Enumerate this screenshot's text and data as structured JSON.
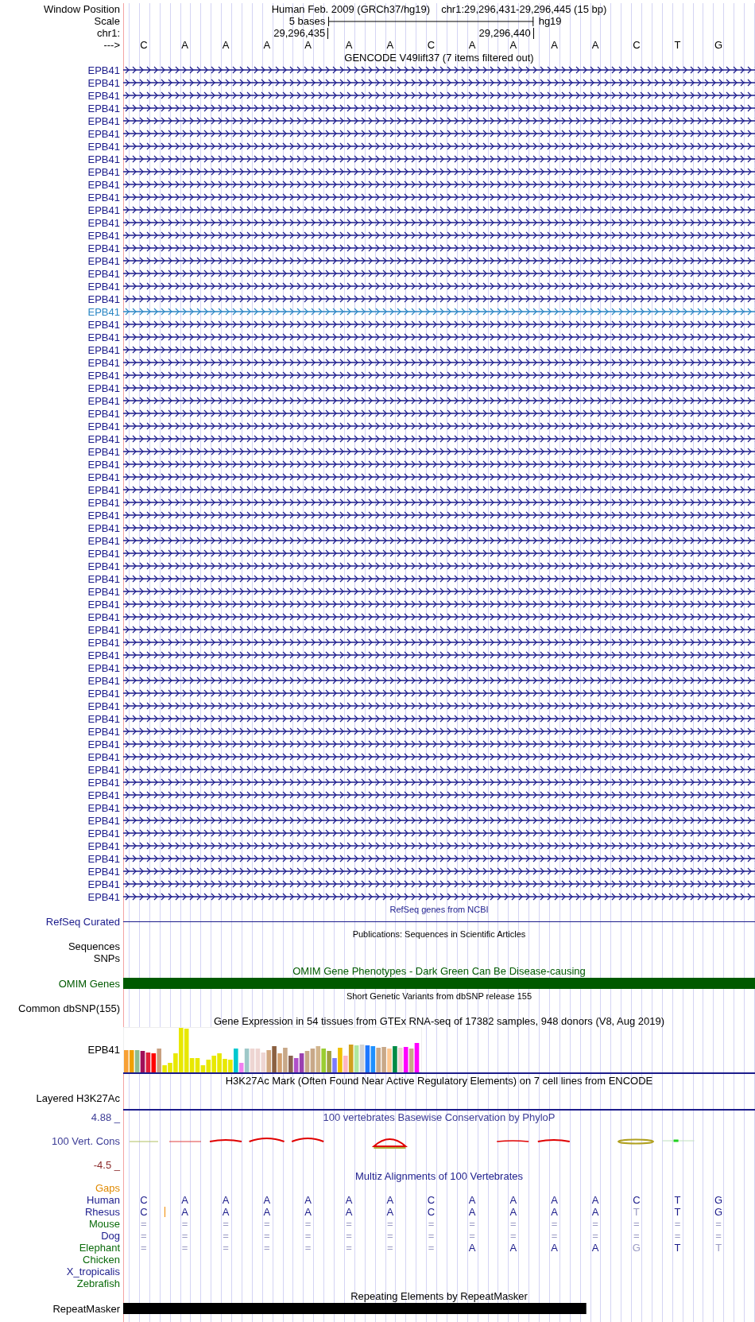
{
  "position": {
    "label": "Window Position",
    "assembly": "Human Feb. 2009 (GRCh37/hg19)",
    "range": "chr1:29,296,431-29,296,445 (15 bp)"
  },
  "scale": {
    "label": "Scale",
    "span": "5 bases",
    "db": "hg19"
  },
  "coordinates": {
    "label": "chr1:",
    "ticks": [
      "29,296,435",
      "29,296,440"
    ]
  },
  "sequence": {
    "label": "--->",
    "bases": [
      "C",
      "A",
      "A",
      "A",
      "A",
      "A",
      "A",
      "C",
      "A",
      "A",
      "A",
      "A",
      "C",
      "T",
      "G"
    ]
  },
  "tracks": [
    {
      "kind": "genes",
      "title": "GENCODE V49lift37 (7 items filtered out)",
      "items": [
        {
          "name": "EPB41",
          "selected": false
        },
        {
          "name": "EPB41",
          "selected": false
        },
        {
          "name": "EPB41",
          "selected": false
        },
        {
          "name": "EPB41",
          "selected": false
        },
        {
          "name": "EPB41",
          "selected": false
        },
        {
          "name": "EPB41",
          "selected": false
        },
        {
          "name": "EPB41",
          "selected": false
        },
        {
          "name": "EPB41",
          "selected": false
        },
        {
          "name": "EPB41",
          "selected": false
        },
        {
          "name": "EPB41",
          "selected": false
        },
        {
          "name": "EPB41",
          "selected": false
        },
        {
          "name": "EPB41",
          "selected": false
        },
        {
          "name": "EPB41",
          "selected": false
        },
        {
          "name": "EPB41",
          "selected": false
        },
        {
          "name": "EPB41",
          "selected": false
        },
        {
          "name": "EPB41",
          "selected": false
        },
        {
          "name": "EPB41",
          "selected": false
        },
        {
          "name": "EPB41",
          "selected": false
        },
        {
          "name": "EPB41",
          "selected": false
        },
        {
          "name": "EPB41",
          "selected": true
        },
        {
          "name": "EPB41",
          "selected": false
        },
        {
          "name": "EPB41",
          "selected": false
        },
        {
          "name": "EPB41",
          "selected": false
        },
        {
          "name": "EPB41",
          "selected": false
        },
        {
          "name": "EPB41",
          "selected": false
        },
        {
          "name": "EPB41",
          "selected": false
        },
        {
          "name": "EPB41",
          "selected": false
        },
        {
          "name": "EPB41",
          "selected": false
        },
        {
          "name": "EPB41",
          "selected": false
        },
        {
          "name": "EPB41",
          "selected": false
        },
        {
          "name": "EPB41",
          "selected": false
        },
        {
          "name": "EPB41",
          "selected": false
        },
        {
          "name": "EPB41",
          "selected": false
        },
        {
          "name": "EPB41",
          "selected": false
        },
        {
          "name": "EPB41",
          "selected": false
        },
        {
          "name": "EPB41",
          "selected": false
        },
        {
          "name": "EPB41",
          "selected": false
        },
        {
          "name": "EPB41",
          "selected": false
        },
        {
          "name": "EPB41",
          "selected": false
        },
        {
          "name": "EPB41",
          "selected": false
        },
        {
          "name": "EPB41",
          "selected": false
        },
        {
          "name": "EPB41",
          "selected": false
        },
        {
          "name": "EPB41",
          "selected": false
        },
        {
          "name": "EPB41",
          "selected": false
        },
        {
          "name": "EPB41",
          "selected": false
        },
        {
          "name": "EPB41",
          "selected": false
        },
        {
          "name": "EPB41",
          "selected": false
        },
        {
          "name": "EPB41",
          "selected": false
        },
        {
          "name": "EPB41",
          "selected": false
        },
        {
          "name": "EPB41",
          "selected": false
        },
        {
          "name": "EPB41",
          "selected": false
        },
        {
          "name": "EPB41",
          "selected": false
        },
        {
          "name": "EPB41",
          "selected": false
        },
        {
          "name": "EPB41",
          "selected": false
        },
        {
          "name": "EPB41",
          "selected": false
        },
        {
          "name": "EPB41",
          "selected": false
        },
        {
          "name": "EPB41",
          "selected": false
        },
        {
          "name": "EPB41",
          "selected": false
        },
        {
          "name": "EPB41",
          "selected": false
        },
        {
          "name": "EPB41",
          "selected": false
        },
        {
          "name": "EPB41",
          "selected": false
        },
        {
          "name": "EPB41",
          "selected": false
        },
        {
          "name": "EPB41",
          "selected": false
        },
        {
          "name": "EPB41",
          "selected": false
        },
        {
          "name": "EPB41",
          "selected": false
        },
        {
          "name": "EPB41",
          "selected": false
        }
      ]
    },
    {
      "kind": "line",
      "title": "RefSeq genes from NCBI",
      "labels": [
        "RefSeq Curated"
      ],
      "color": "#1c1c8c"
    },
    {
      "kind": "empty",
      "title": "Publications: Sequences in Scientific Articles",
      "labels": [
        "Sequences",
        "SNPs"
      ],
      "color": "#000000"
    },
    {
      "kind": "bar",
      "title": "OMIM Gene Phenotypes - Dark Green Can Be Disease-causing",
      "labels": [
        "OMIM Genes"
      ],
      "color": "#005a00",
      "level": 1
    },
    {
      "kind": "empty",
      "title": "Short Genetic Variants from dbSNP release 155",
      "labels": [
        "Common dbSNP(155)"
      ],
      "color": "#000000"
    },
    {
      "kind": "expression",
      "title": "Gene Expression in 54 tissues from GTEx RNA-seq of 17382 samples, 948 donors (V8, Aug 2019)",
      "labels": [
        "EPB41"
      ],
      "color": "#000000"
    },
    {
      "kind": "layered",
      "title": "H3K27Ac Mark (Often Found Near Active Regulatory Elements) on 7 cell lines from ENCODE",
      "labels": [
        "Layered H3K27Ac"
      ],
      "color": "#000000"
    },
    {
      "kind": "wiggle",
      "title": "100 vertebrates Basewise Conservation by PhyloP",
      "max": "4.88 _",
      "name": "100 Vert. Cons",
      "min": "-4.5 _",
      "color": "#3c3c96"
    },
    {
      "kind": "alignment",
      "title": "Multiz Alignments of 100 Vertebrates",
      "gaps": "Gaps",
      "species": [
        {
          "name": "Human",
          "color": "#1c1c8c",
          "bases": [
            {
              "b": "C",
              "faded": false
            },
            {
              "b": "A",
              "faded": false
            },
            {
              "b": "A",
              "faded": false
            },
            {
              "b": "A",
              "faded": false
            },
            {
              "b": "A",
              "faded": false
            },
            {
              "b": "A",
              "faded": false
            },
            {
              "b": "A",
              "faded": false
            },
            {
              "b": "C",
              "faded": false
            },
            {
              "b": "A",
              "faded": false
            },
            {
              "b": "A",
              "faded": false
            },
            {
              "b": "A",
              "faded": false
            },
            {
              "b": "A",
              "faded": false
            },
            {
              "b": "C",
              "faded": false
            },
            {
              "b": "T",
              "faded": false
            },
            {
              "b": "G",
              "faded": false
            }
          ]
        },
        {
          "name": "Rhesus",
          "color": "#1c1c8c",
          "bases": [
            {
              "b": "C",
              "faded": false,
              "insertion": true
            },
            {
              "b": "A",
              "faded": false
            },
            {
              "b": "A",
              "faded": false
            },
            {
              "b": "A",
              "faded": false
            },
            {
              "b": "A",
              "faded": false
            },
            {
              "b": "A",
              "faded": false
            },
            {
              "b": "A",
              "faded": false
            },
            {
              "b": "C",
              "faded": false
            },
            {
              "b": "A",
              "faded": false
            },
            {
              "b": "A",
              "faded": false
            },
            {
              "b": "A",
              "faded": false
            },
            {
              "b": "A",
              "faded": false
            },
            {
              "b": "T",
              "faded": true
            },
            {
              "b": "T",
              "faded": false
            },
            {
              "b": "G",
              "faded": false
            }
          ]
        },
        {
          "name": "Mouse",
          "color": "#0b6b0b",
          "bases": [
            {
              "b": "=",
              "faded": true
            },
            {
              "b": "=",
              "faded": true
            },
            {
              "b": "=",
              "faded": true
            },
            {
              "b": "=",
              "faded": true
            },
            {
              "b": "=",
              "faded": true
            },
            {
              "b": "=",
              "faded": true
            },
            {
              "b": "=",
              "faded": true
            },
            {
              "b": "=",
              "faded": true
            },
            {
              "b": "=",
              "faded": true
            },
            {
              "b": "=",
              "faded": true
            },
            {
              "b": "=",
              "faded": true
            },
            {
              "b": "=",
              "faded": true
            },
            {
              "b": "=",
              "faded": true
            },
            {
              "b": "=",
              "faded": true
            },
            {
              "b": "=",
              "faded": true
            }
          ]
        },
        {
          "name": "Dog",
          "color": "#1c1c8c",
          "bases": [
            {
              "b": "=",
              "faded": true
            },
            {
              "b": "=",
              "faded": true
            },
            {
              "b": "=",
              "faded": true
            },
            {
              "b": "=",
              "faded": true
            },
            {
              "b": "=",
              "faded": true
            },
            {
              "b": "=",
              "faded": true
            },
            {
              "b": "=",
              "faded": true
            },
            {
              "b": "=",
              "faded": true
            },
            {
              "b": "=",
              "faded": true
            },
            {
              "b": "=",
              "faded": true
            },
            {
              "b": "=",
              "faded": true
            },
            {
              "b": "=",
              "faded": true
            },
            {
              "b": "=",
              "faded": true
            },
            {
              "b": "=",
              "faded": true
            },
            {
              "b": "=",
              "faded": true
            }
          ]
        },
        {
          "name": "Elephant",
          "color": "#0b6b0b",
          "bases": [
            {
              "b": "=",
              "faded": true
            },
            {
              "b": "=",
              "faded": true
            },
            {
              "b": "=",
              "faded": true
            },
            {
              "b": "=",
              "faded": true
            },
            {
              "b": "=",
              "faded": true
            },
            {
              "b": "=",
              "faded": true
            },
            {
              "b": "=",
              "faded": true
            },
            {
              "b": "=",
              "faded": true
            },
            {
              "b": "A",
              "faded": false
            },
            {
              "b": "A",
              "faded": false
            },
            {
              "b": "A",
              "faded": false
            },
            {
              "b": "A",
              "faded": false
            },
            {
              "b": "G",
              "faded": true
            },
            {
              "b": "T",
              "faded": false
            },
            {
              "b": "T",
              "faded": true
            }
          ]
        },
        {
          "name": "Chicken",
          "color": "#0b6b0b"
        },
        {
          "name": "X_tropicalis",
          "color": "#1c1c8c"
        },
        {
          "name": "Zebrafish",
          "color": "#0b6b0b"
        }
      ]
    },
    {
      "kind": "bar",
      "title": "Repeating Elements by RepeatMasker",
      "labels": [
        "RepeatMasker"
      ],
      "color": "#000000",
      "level": 0.733
    }
  ]
}
